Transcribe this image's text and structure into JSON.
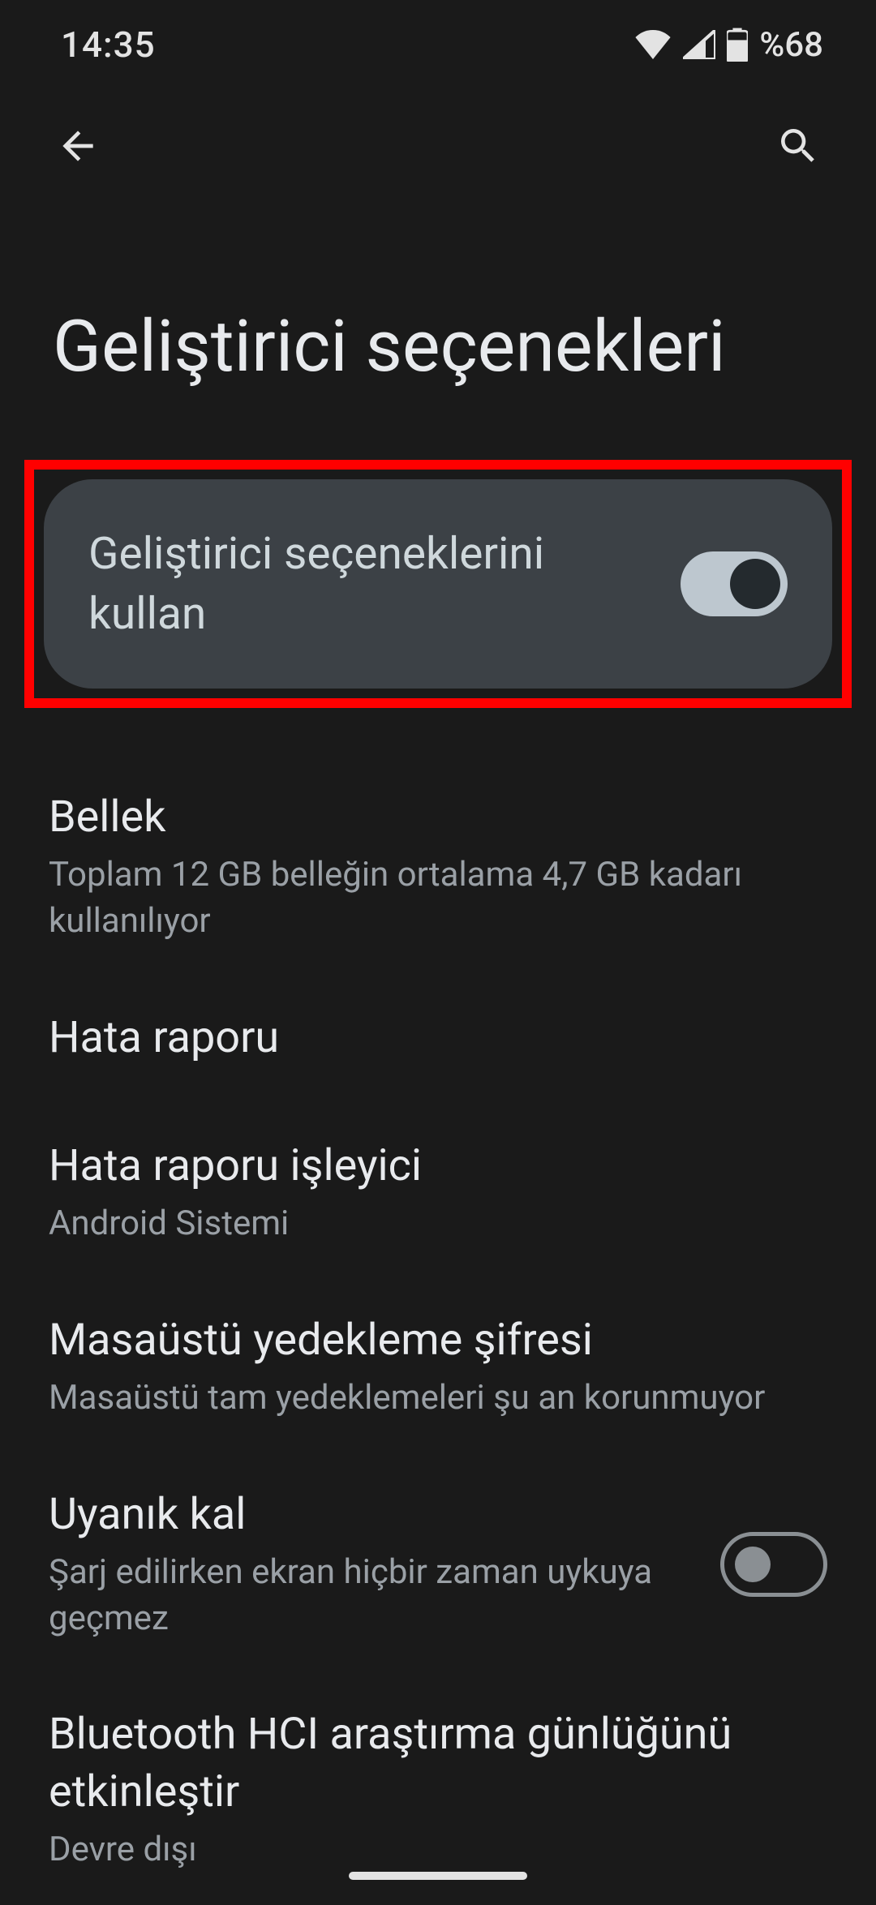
{
  "statusbar": {
    "time": "14:35",
    "battery_text": "%68"
  },
  "page": {
    "title": "Geliştirici seçenekleri"
  },
  "master_toggle": {
    "label": "Geliştirici seçeneklerini kullan",
    "on": true
  },
  "items": [
    {
      "title": "Bellek",
      "subtitle": "Toplam 12 GB belleğin ortalama 4,7 GB kadarı kullanılıyor",
      "has_toggle": false
    },
    {
      "title": "Hata raporu",
      "subtitle": "",
      "has_toggle": false
    },
    {
      "title": "Hata raporu işleyici",
      "subtitle": "Android Sistemi",
      "has_toggle": false
    },
    {
      "title": "Masaüstü yedekleme şifresi",
      "subtitle": "Masaüstü tam yedeklemeleri şu an korunmuyor",
      "has_toggle": false
    },
    {
      "title": "Uyanık kal",
      "subtitle": "Şarj edilirken ekran hiçbir zaman uykuya geçmez",
      "has_toggle": true,
      "toggle_on": false
    },
    {
      "title": "Bluetooth HCI araştırma günlüğünü etkinleştir",
      "subtitle": "Devre dışı",
      "has_toggle": false
    }
  ]
}
